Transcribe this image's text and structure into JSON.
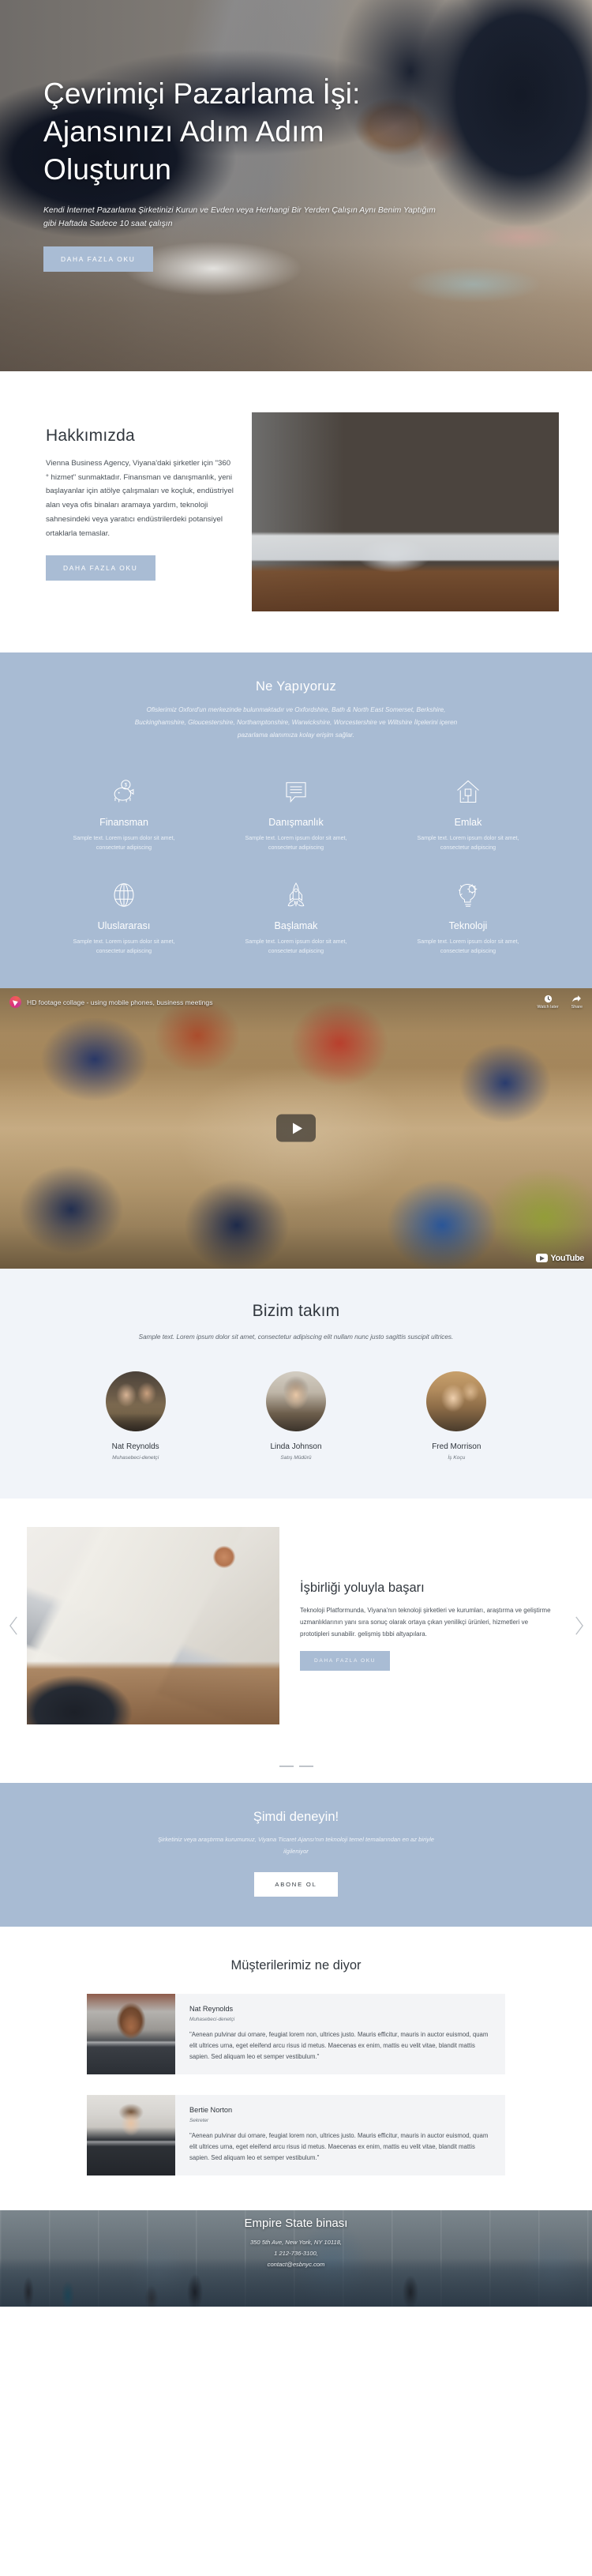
{
  "hero": {
    "title": "Çevrimiçi Pazarlama İşi: Ajansınızı Adım Adım Oluşturun",
    "subtitle": "Kendi İnternet Pazarlama Şirketinizi Kurun ve Evden veya Herhangi Bir Yerden Çalışın Aynı Benim Yaptığım gibi Haftada Sadece 10 saat çalışın",
    "cta": "DAHA FAZLA OKU"
  },
  "about": {
    "title": "Hakkımızda",
    "body": "Vienna Business Agency, Viyana'daki şirketler için \"360 ° hizmet\" sunmaktadır. Finansman ve danışmanlık, yeni başlayanlar için atölye çalışmaları ve koçluk, endüstriyel alan veya ofis binaları aramaya yardım, teknoloji sahnesindeki veya yaratıcı endüstrilerdeki potansiyel ortaklarla temaslar.",
    "cta": "DAHA FAZLA OKU"
  },
  "services": {
    "title": "Ne Yapıyoruz",
    "subtitle": "Ofislerimiz Oxford'un merkezinde bulunmaktadır ve Oxfordshire, Bath & North East Somerset, Berkshire, Buckinghamshire, Gloucestershire, Northamptonshire, Warwickshire, Worcestershire ve Wiltshire İlçelerini içeren pazarlama alanımıza kolay erişim sağlar.",
    "items": [
      {
        "icon": "piggy-bank-icon",
        "name": "Finansman",
        "text": "Sample text. Lorem ipsum dolor sit amet, consectetur adipiscing"
      },
      {
        "icon": "chat-bubble-icon",
        "name": "Danışmanlık",
        "text": "Sample text. Lorem ipsum dolor sit amet, consectetur adipiscing"
      },
      {
        "icon": "house-icon",
        "name": "Emlak",
        "text": "Sample text. Lorem ipsum dolor sit amet, consectetur adipiscing"
      },
      {
        "icon": "globe-icon",
        "name": "Uluslararası",
        "text": "Sample text. Lorem ipsum dolor sit amet, consectetur adipiscing"
      },
      {
        "icon": "rocket-icon",
        "name": "Başlamak",
        "text": "Sample text. Lorem ipsum dolor sit amet, consectetur adipiscing"
      },
      {
        "icon": "lightbulb-gear-icon",
        "name": "Teknoloji",
        "text": "Sample text. Lorem ipsum dolor sit amet, consectetur adipiscing"
      }
    ]
  },
  "video": {
    "caption": "HD footage collage - using mobile phones, business meetings",
    "watch_later": "Watch later",
    "share": "Share",
    "brand": "YouTube"
  },
  "team": {
    "title": "Bizim takım",
    "subtitle": "Sample text. Lorem ipsum dolor sit amet, consectetur adipiscing elit nullam nunc justo sagittis suscipit ultrices.",
    "members": [
      {
        "name": "Nat Reynolds",
        "role": "Muhasebeci-denetçi"
      },
      {
        "name": "Linda Johnson",
        "role": "Satış Müdürü"
      },
      {
        "name": "Fred Morrison",
        "role": "İş Koçu"
      }
    ]
  },
  "collab": {
    "title": "İşbirliği yoluyla başarı",
    "body": "Teknoloji Platformunda, Viyana'nın teknoloji şirketleri ve kurumları, araştırma ve geliştirme uzmanlıklarının yanı sıra sonuç olarak ortaya çıkan yenilikçi ürünleri, hizmetleri ve prototipleri sunabilir. gelişmiş tıbbi altyapılara.",
    "cta": "DAHA FAZLA OKU",
    "prev_arrow": "chevron-left-icon",
    "next_arrow": "chevron-right-icon"
  },
  "subscribe": {
    "title": "Şimdi deneyin!",
    "text": "Şirketiniz veya araştırma kurumunuz, Viyana Ticaret Ajansı'nın teknoloji temel temalarından en az biriyle ilgileniyor",
    "cta": "ABONE OL"
  },
  "testimonials": {
    "title": "Müşterilerimiz ne diyor",
    "items": [
      {
        "name": "Nat Reynolds",
        "role": "Muhasebeci-denetçi",
        "quote": "\"Aenean pulvinar dui ornare, feugiat lorem non, ultrices justo. Mauris efficitur, mauris in auctor euismod, quam elit ultrices urna, eget eleifend arcu risus id metus. Maecenas ex enim, mattis eu velit vitae, blandit mattis sapien. Sed aliquam leo et semper vestibulum.\""
      },
      {
        "name": "Bertie Norton",
        "role": "Sekreter",
        "quote": "\"Aenean pulvinar dui ornare, feugiat lorem non, ultrices justo. Mauris efficitur, mauris in auctor euismod, quam elit ultrices urna, eget eleifend arcu risus id metus. Maecenas ex enim, mattis eu velit vitae, blandit mattis sapien. Sed aliquam leo et semper vestibulum.\""
      }
    ]
  },
  "footer": {
    "title": "Empire State binası",
    "address": "350 5th Ave, New York, NY 10118,\n1 212-736-3100,\ncontact@esbnyc.com"
  },
  "colors": {
    "accent": "#a8bbd3",
    "dark_text": "#31373e",
    "light_bg": "#f1f4f9",
    "card_bg": "#f3f4f6"
  }
}
